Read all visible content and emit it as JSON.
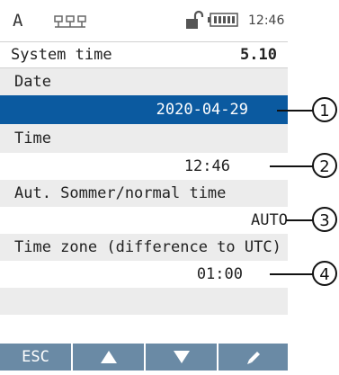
{
  "status_bar": {
    "mode_letter": "A",
    "network_icon": "network-icon",
    "lock_icon": "unlock-icon",
    "battery_icon": "battery-icon",
    "time": "12:46"
  },
  "header": {
    "title": "System time",
    "version": "5.10"
  },
  "fields": [
    {
      "label": "Date",
      "value": "2020-04-29",
      "callout": "1",
      "selected": true
    },
    {
      "label": "Time",
      "value": "12:46",
      "callout": "2",
      "selected": false
    },
    {
      "label": "Aut. Sommer/normal time",
      "value": "AUTO",
      "callout": "3",
      "selected": false
    },
    {
      "label": "Time zone (difference to UTC)",
      "value": "01:00",
      "callout": "4",
      "selected": false
    }
  ],
  "function_keys": [
    {
      "label": "ESC",
      "icon": ""
    },
    {
      "label": "",
      "icon": "up-arrow-icon"
    },
    {
      "label": "",
      "icon": "down-arrow-icon"
    },
    {
      "label": "",
      "icon": "pencil-icon"
    }
  ],
  "colors": {
    "selection": "#0b5aa0",
    "fkey_bar": "#6a8aa5",
    "label_bg": "#ececec"
  }
}
